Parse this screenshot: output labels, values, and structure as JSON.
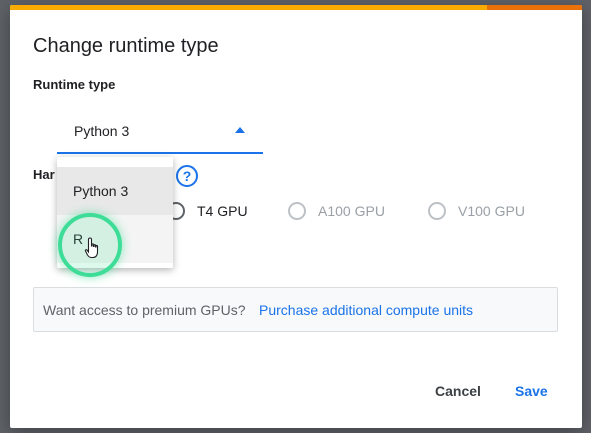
{
  "dialog": {
    "title": "Change runtime type",
    "runtime_label": "Runtime type",
    "runtime_selected": "Python 3",
    "hardware_label": "Hardware accelerator",
    "hardware_label_visible": "Har",
    "help_symbol": "?",
    "runtime_options": [
      "Python 3",
      "R"
    ],
    "accelerators": [
      {
        "label": "T4 GPU",
        "enabled": true
      },
      {
        "label": "A100 GPU",
        "enabled": false
      },
      {
        "label": "V100 GPU",
        "enabled": false
      }
    ],
    "premium": {
      "text": "Want access to premium GPUs?",
      "link": "Purchase additional compute units"
    },
    "buttons": {
      "cancel": "Cancel",
      "save": "Save"
    }
  },
  "colors": {
    "accent": "#1a73e8",
    "top_bar": "#f9ab00",
    "top_bar_end": "#e8710a",
    "cursor_highlight": "#3ddc97"
  },
  "icons": {
    "help": "help-icon",
    "dropdown_arrow": "caret-up-icon",
    "cursor": "hand-pointer-icon"
  }
}
